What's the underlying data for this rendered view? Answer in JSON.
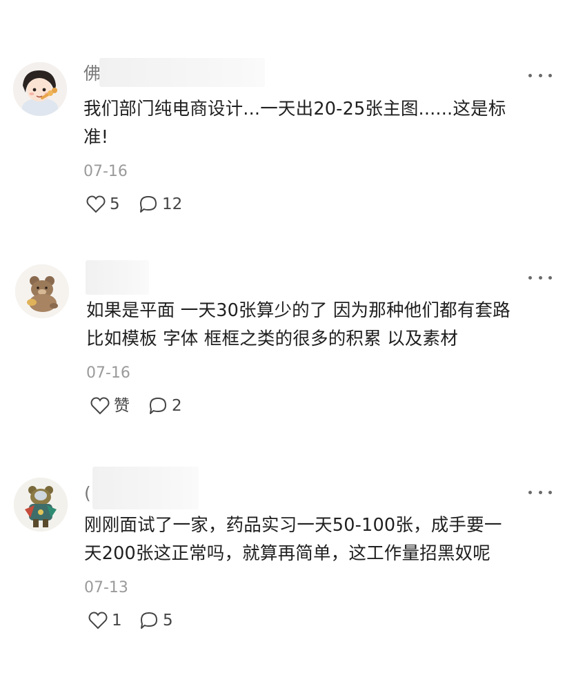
{
  "comments": [
    {
      "name_visible": "佛",
      "text_lines": [
        "我们部门纯电商设计...一天出20-25张主图......这是标",
        "准!"
      ],
      "date": "07-16",
      "likes": "5",
      "replies": "12"
    },
    {
      "name_visible": "",
      "text_lines": [
        "如果是平面 一天30张算少的了 因为那种他们都有套路",
        "比如模板 字体 框框之类的很多的积累 以及素材"
      ],
      "date": "07-16",
      "likes": "赞",
      "replies": "2"
    },
    {
      "name_visible": "(",
      "text_lines": [
        "刚刚面试了一家，药品实习一天50-100张，成手要一",
        "天200张这正常吗，就算再简单，这工作量招黑奴呢"
      ],
      "date": "07-13",
      "likes": "1",
      "replies": "5"
    }
  ],
  "icons": {
    "like": "heart-outline-icon",
    "reply": "speech-bubble-icon",
    "more": "ellipsis-icon"
  },
  "colors": {
    "text": "#1f1f1f",
    "muted": "#9a9a9a",
    "icon": "#444444"
  }
}
